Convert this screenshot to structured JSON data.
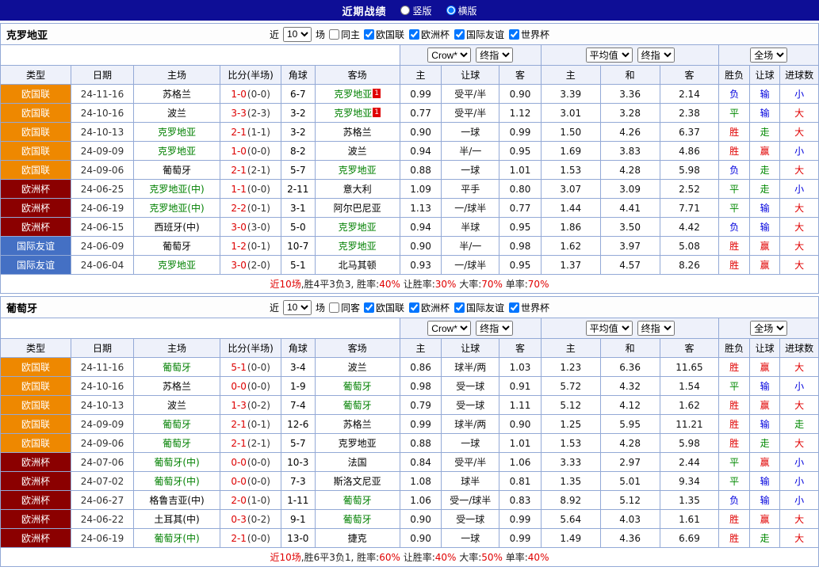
{
  "topbar": {
    "title": "近期战绩",
    "options": [
      {
        "label": "竖版",
        "selected": false
      },
      {
        "label": "横版",
        "selected": true
      }
    ]
  },
  "filter": {
    "near_label": "近",
    "count_value": "10",
    "count_suffix": "场",
    "leagues": [
      "欧国联",
      "欧洲杯",
      "国际友谊",
      "世界杯"
    ]
  },
  "table_header": {
    "labels": [
      "类型",
      "日期",
      "主场",
      "比分(半场)",
      "角球",
      "客场",
      "主",
      "让球",
      "客",
      "主",
      "和",
      "客",
      "胜负",
      "让球",
      "进球数"
    ],
    "group_selects": [
      [
        "Crow*",
        "终指"
      ],
      [
        "平均值",
        "终指"
      ],
      [
        "全场"
      ]
    ]
  },
  "colors": {
    "league": {
      "欧国联": "#ee8800",
      "欧洲杯": "#8b0000",
      "国际友谊": "#4470c4"
    },
    "result": {
      "胜": "#e00000",
      "赢": "#e00000",
      "大": "#e00000",
      "平": "#008800",
      "走": "#008800",
      "负": "#0000dd",
      "输": "#0000dd",
      "小": "#0000dd"
    },
    "focus_team": "#008000",
    "score": "#dd0000"
  },
  "sections": [
    {
      "team": "克罗地亚",
      "same_label": "同主",
      "rows": [
        {
          "league": "欧国联",
          "date": "24-11-16",
          "home": "苏格兰",
          "score": "1-0",
          "half": "(0-0)",
          "corners": "6-7",
          "away": "克罗地亚",
          "focus": "away",
          "away_badge": "1",
          "asian": [
            "0.99",
            "受平/半",
            "0.90"
          ],
          "europe": [
            "3.39",
            "3.36",
            "2.14"
          ],
          "results": [
            "负",
            "输",
            "小"
          ]
        },
        {
          "league": "欧国联",
          "date": "24-10-16",
          "home": "波兰",
          "score": "3-3",
          "half": "(2-3)",
          "corners": "3-2",
          "away": "克罗地亚",
          "focus": "away",
          "away_badge": "1",
          "asian": [
            "0.77",
            "受平/半",
            "1.12"
          ],
          "europe": [
            "3.01",
            "3.28",
            "2.38"
          ],
          "results": [
            "平",
            "输",
            "大"
          ]
        },
        {
          "league": "欧国联",
          "date": "24-10-13",
          "home": "克罗地亚",
          "score": "2-1",
          "half": "(1-1)",
          "corners": "3-2",
          "away": "苏格兰",
          "focus": "home",
          "asian": [
            "0.90",
            "一球",
            "0.99"
          ],
          "europe": [
            "1.50",
            "4.26",
            "6.37"
          ],
          "results": [
            "胜",
            "走",
            "大"
          ]
        },
        {
          "league": "欧国联",
          "date": "24-09-09",
          "home": "克罗地亚",
          "score": "1-0",
          "half": "(0-0)",
          "corners": "8-2",
          "away": "波兰",
          "focus": "home",
          "asian": [
            "0.94",
            "半/一",
            "0.95"
          ],
          "europe": [
            "1.69",
            "3.83",
            "4.86"
          ],
          "results": [
            "胜",
            "赢",
            "小"
          ]
        },
        {
          "league": "欧国联",
          "date": "24-09-06",
          "home": "葡萄牙",
          "score": "2-1",
          "half": "(2-1)",
          "corners": "5-7",
          "away": "克罗地亚",
          "focus": "away",
          "asian": [
            "0.88",
            "一球",
            "1.01"
          ],
          "europe": [
            "1.53",
            "4.28",
            "5.98"
          ],
          "results": [
            "负",
            "走",
            "大"
          ]
        },
        {
          "league": "欧洲杯",
          "date": "24-06-25",
          "home": "克罗地亚(中)",
          "score": "1-1",
          "half": "(0-0)",
          "corners": "2-11",
          "away": "意大利",
          "focus": "home",
          "asian": [
            "1.09",
            "平手",
            "0.80"
          ],
          "europe": [
            "3.07",
            "3.09",
            "2.52"
          ],
          "results": [
            "平",
            "走",
            "小"
          ]
        },
        {
          "league": "欧洲杯",
          "date": "24-06-19",
          "home": "克罗地亚(中)",
          "score": "2-2",
          "half": "(0-1)",
          "corners": "3-1",
          "away": "阿尔巴尼亚",
          "focus": "home",
          "asian": [
            "1.13",
            "一/球半",
            "0.77"
          ],
          "europe": [
            "1.44",
            "4.41",
            "7.71"
          ],
          "results": [
            "平",
            "输",
            "大"
          ]
        },
        {
          "league": "欧洲杯",
          "date": "24-06-15",
          "home": "西班牙(中)",
          "score": "3-0",
          "half": "(3-0)",
          "corners": "5-0",
          "away": "克罗地亚",
          "focus": "away",
          "asian": [
            "0.94",
            "半球",
            "0.95"
          ],
          "europe": [
            "1.86",
            "3.50",
            "4.42"
          ],
          "results": [
            "负",
            "输",
            "大"
          ]
        },
        {
          "league": "国际友谊",
          "date": "24-06-09",
          "home": "葡萄牙",
          "score": "1-2",
          "half": "(0-1)",
          "corners": "10-7",
          "away": "克罗地亚",
          "focus": "away",
          "asian": [
            "0.90",
            "半/一",
            "0.98"
          ],
          "europe": [
            "1.62",
            "3.97",
            "5.08"
          ],
          "results": [
            "胜",
            "赢",
            "大"
          ]
        },
        {
          "league": "国际友谊",
          "date": "24-06-04",
          "home": "克罗地亚",
          "score": "3-0",
          "half": "(2-0)",
          "corners": "5-1",
          "away": "北马其顿",
          "focus": "home",
          "asian": [
            "0.93",
            "一/球半",
            "0.95"
          ],
          "europe": [
            "1.37",
            "4.57",
            "8.26"
          ],
          "results": [
            "胜",
            "赢",
            "大"
          ]
        }
      ],
      "summary": [
        {
          "text": "近10场",
          "red": true
        },
        {
          "text": ",胜4平3负3, 胜率:",
          "red": false
        },
        {
          "text": "40%",
          "red": true
        },
        {
          "text": " 让胜率:",
          "red": false
        },
        {
          "text": "30%",
          "red": true
        },
        {
          "text": " 大率:",
          "red": false
        },
        {
          "text": "70%",
          "red": true
        },
        {
          "text": " 单率:",
          "red": false
        },
        {
          "text": "70%",
          "red": true
        }
      ]
    },
    {
      "team": "葡萄牙",
      "same_label": "同客",
      "rows": [
        {
          "league": "欧国联",
          "date": "24-11-16",
          "home": "葡萄牙",
          "score": "5-1",
          "half": "(0-0)",
          "corners": "3-4",
          "away": "波兰",
          "focus": "home",
          "asian": [
            "0.86",
            "球半/两",
            "1.03"
          ],
          "europe": [
            "1.23",
            "6.36",
            "11.65"
          ],
          "results": [
            "胜",
            "赢",
            "大"
          ]
        },
        {
          "league": "欧国联",
          "date": "24-10-16",
          "home": "苏格兰",
          "score": "0-0",
          "half": "(0-0)",
          "corners": "1-9",
          "away": "葡萄牙",
          "focus": "away",
          "asian": [
            "0.98",
            "受一球",
            "0.91"
          ],
          "europe": [
            "5.72",
            "4.32",
            "1.54"
          ],
          "results": [
            "平",
            "输",
            "小"
          ]
        },
        {
          "league": "欧国联",
          "date": "24-10-13",
          "home": "波兰",
          "score": "1-3",
          "half": "(0-2)",
          "corners": "7-4",
          "away": "葡萄牙",
          "focus": "away",
          "asian": [
            "0.79",
            "受一球",
            "1.11"
          ],
          "europe": [
            "5.12",
            "4.12",
            "1.62"
          ],
          "results": [
            "胜",
            "赢",
            "大"
          ]
        },
        {
          "league": "欧国联",
          "date": "24-09-09",
          "home": "葡萄牙",
          "score": "2-1",
          "half": "(0-1)",
          "corners": "12-6",
          "away": "苏格兰",
          "focus": "home",
          "asian": [
            "0.99",
            "球半/两",
            "0.90"
          ],
          "europe": [
            "1.25",
            "5.95",
            "11.21"
          ],
          "results": [
            "胜",
            "输",
            "走"
          ]
        },
        {
          "league": "欧国联",
          "date": "24-09-06",
          "home": "葡萄牙",
          "score": "2-1",
          "half": "(2-1)",
          "corners": "5-7",
          "away": "克罗地亚",
          "focus": "home",
          "asian": [
            "0.88",
            "一球",
            "1.01"
          ],
          "europe": [
            "1.53",
            "4.28",
            "5.98"
          ],
          "results": [
            "胜",
            "走",
            "大"
          ]
        },
        {
          "league": "欧洲杯",
          "date": "24-07-06",
          "home": "葡萄牙(中)",
          "score": "0-0",
          "half": "(0-0)",
          "corners": "10-3",
          "away": "法国",
          "focus": "home",
          "asian": [
            "0.84",
            "受平/半",
            "1.06"
          ],
          "europe": [
            "3.33",
            "2.97",
            "2.44"
          ],
          "results": [
            "平",
            "赢",
            "小"
          ]
        },
        {
          "league": "欧洲杯",
          "date": "24-07-02",
          "home": "葡萄牙(中)",
          "score": "0-0",
          "half": "(0-0)",
          "corners": "7-3",
          "away": "斯洛文尼亚",
          "focus": "home",
          "asian": [
            "1.08",
            "球半",
            "0.81"
          ],
          "europe": [
            "1.35",
            "5.01",
            "9.34"
          ],
          "results": [
            "平",
            "输",
            "小"
          ]
        },
        {
          "league": "欧洲杯",
          "date": "24-06-27",
          "home": "格鲁吉亚(中)",
          "score": "2-0",
          "half": "(1-0)",
          "corners": "1-11",
          "away": "葡萄牙",
          "focus": "away",
          "asian": [
            "1.06",
            "受一/球半",
            "0.83"
          ],
          "europe": [
            "8.92",
            "5.12",
            "1.35"
          ],
          "results": [
            "负",
            "输",
            "小"
          ]
        },
        {
          "league": "欧洲杯",
          "date": "24-06-22",
          "home": "土耳其(中)",
          "score": "0-3",
          "half": "(0-2)",
          "corners": "9-1",
          "away": "葡萄牙",
          "focus": "away",
          "asian": [
            "0.90",
            "受一球",
            "0.99"
          ],
          "europe": [
            "5.64",
            "4.03",
            "1.61"
          ],
          "results": [
            "胜",
            "赢",
            "大"
          ]
        },
        {
          "league": "欧洲杯",
          "date": "24-06-19",
          "home": "葡萄牙(中)",
          "score": "2-1",
          "half": "(0-0)",
          "corners": "13-0",
          "away": "捷克",
          "focus": "home",
          "asian": [
            "0.90",
            "一球",
            "0.99"
          ],
          "europe": [
            "1.49",
            "4.36",
            "6.69"
          ],
          "results": [
            "胜",
            "走",
            "大"
          ]
        }
      ],
      "summary": [
        {
          "text": "近10场",
          "red": true
        },
        {
          "text": ",胜6平3负1, 胜率:",
          "red": false
        },
        {
          "text": "60%",
          "red": true
        },
        {
          "text": " 让胜率:",
          "red": false
        },
        {
          "text": "40%",
          "red": true
        },
        {
          "text": " 大率:",
          "red": false
        },
        {
          "text": "50%",
          "red": true
        },
        {
          "text": " 单率:",
          "red": false
        },
        {
          "text": "40%",
          "red": true
        }
      ]
    }
  ]
}
